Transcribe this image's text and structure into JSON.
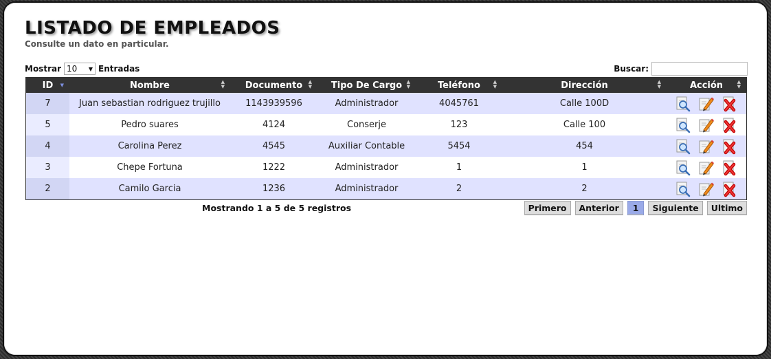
{
  "header": {
    "title": "LISTADO DE EMPLEADOS",
    "subtitle": "Consulte un dato en particular."
  },
  "controls": {
    "show_label": "Mostrar",
    "show_value": "10",
    "entries_label": "Entradas",
    "search_label": "Buscar:",
    "search_value": ""
  },
  "table": {
    "columns": [
      "ID",
      "Nombre",
      "Documento",
      "Tipo De Cargo",
      "Teléfono",
      "Dirección",
      "Acción"
    ],
    "rows": [
      [
        "7",
        "Juan sebastian rodriguez trujillo",
        "1143939596",
        "Administrador",
        "4045761",
        "Calle 100D"
      ],
      [
        "5",
        "Pedro suares",
        "4124",
        "Conserje",
        "123",
        "Calle 100"
      ],
      [
        "4",
        "Carolina Perez",
        "4545",
        "Auxiliar Contable",
        "5454",
        "454"
      ],
      [
        "3",
        "Chepe Fortuna",
        "1222",
        "Administrador",
        "1",
        "1"
      ],
      [
        "2",
        "Camilo Garcia",
        "1236",
        "Administrador",
        "2",
        "2"
      ]
    ],
    "action_icons": [
      "view-icon",
      "edit-icon",
      "delete-icon"
    ]
  },
  "footer": {
    "info": "Mostrando 1 a 5 de 5 registros",
    "first": "Primero",
    "previous": "Anterior",
    "current_page": "1",
    "next": "Siguiente",
    "last": "Ultimo"
  },
  "colors": {
    "header_bg": "#333333",
    "row_odd": "#e0e2ff",
    "row_even": "#ffffff",
    "current_page": "#9aaae8"
  }
}
